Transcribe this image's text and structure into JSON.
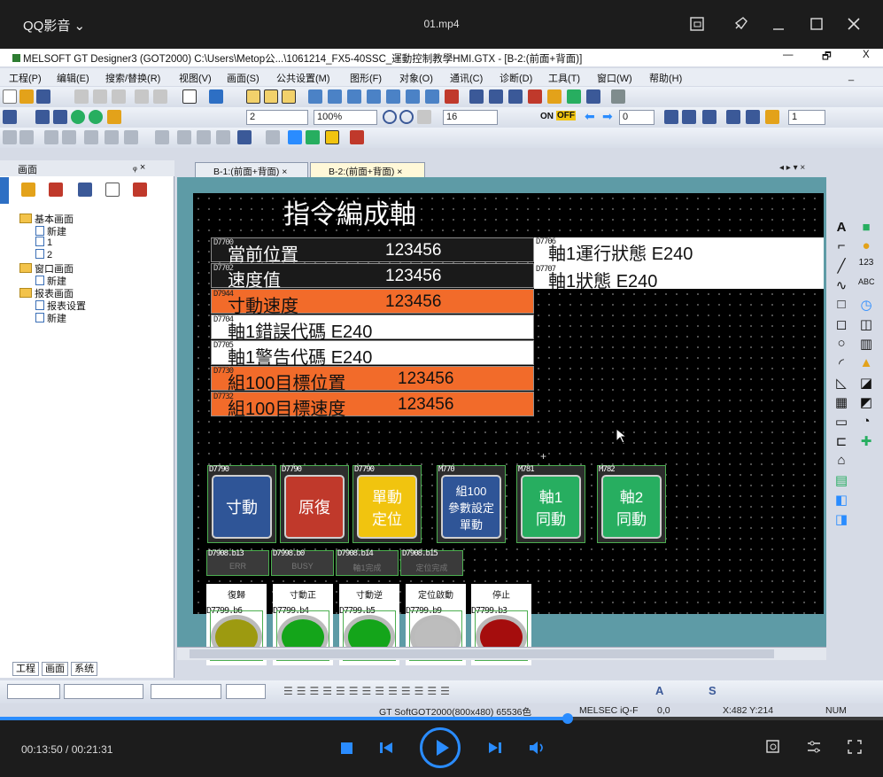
{
  "player": {
    "app_title": "QQ影音",
    "app_chevron": "⌄",
    "file": "01.mp4",
    "time": "00:13:50 / 00:21:31",
    "progress": 0.643,
    "icons": [
      "screenshot-icon",
      "pin-icon",
      "minimize-icon",
      "maximize-icon",
      "close-icon",
      "stop-icon",
      "prev-icon",
      "play-icon",
      "next-icon",
      "volume-icon",
      "capture-icon",
      "settings-icon",
      "fullscreen-icon"
    ],
    "accent": "#2a8cff"
  },
  "window": {
    "title": "MELSOFT GT Designer3 (GOT2000) C:\\Users\\Metop公...\\1061214_FX5-40SSC_運動控制教學HMI.GTX - [B-2:(前面+背面)]",
    "min": "—",
    "restore": "🗗",
    "close": "X",
    "mdi_min": "_",
    "mdi_close": "🗗 ×"
  },
  "menu": [
    "工程(P)",
    "编辑(E)",
    "搜索/替换(R)",
    "视图(V)",
    "画面(S)",
    "公共设置(M)",
    "图形(F)",
    "对象(O)",
    "通讯(C)",
    "诊断(D)",
    "工具(T)",
    "窗口(W)",
    "帮助(H)"
  ],
  "toolbar": {
    "layer": "2",
    "zoom": "100%",
    "grid": "16",
    "on_label": "ON",
    "off_label": "OFF",
    "offset": "0",
    "page": "1"
  },
  "panel": {
    "title": "画面",
    "pin": "ᵩ ×",
    "tree": [
      {
        "label": "基本画面",
        "level": 0,
        "type": "folder"
      },
      {
        "label": "新建",
        "level": 1,
        "type": "new"
      },
      {
        "label": "1",
        "level": 1,
        "type": "file"
      },
      {
        "label": "2",
        "level": 1,
        "type": "file"
      },
      {
        "label": "窗口画面",
        "level": 0,
        "type": "folder"
      },
      {
        "label": "新建",
        "level": 1,
        "type": "new"
      },
      {
        "label": "报表画面",
        "level": 0,
        "type": "folder"
      },
      {
        "label": "报表设置",
        "level": 1,
        "type": "file"
      },
      {
        "label": "新建",
        "level": 1,
        "type": "new"
      }
    ],
    "bottom_tabs": [
      "工程",
      "画面",
      "系统"
    ]
  },
  "tabs": [
    "B-1:(前面+背面)",
    "B-2:(前面+背面)"
  ],
  "tab_controls": "◂ ▸ ▾ ×",
  "hmi": {
    "title": "指令編成軸",
    "rows": [
      {
        "tag": "D7700",
        "label": "當前位置",
        "value": "123456",
        "style": "dark"
      },
      {
        "tag": "D7702",
        "label": "速度值",
        "value": "123456",
        "style": "dark"
      },
      {
        "tag": "D7944",
        "label": "寸動速度",
        "value": "123456",
        "style": "orange"
      },
      {
        "tag": "D7704",
        "label": "軸1錯誤代碼",
        "value": "E240",
        "style": "white"
      },
      {
        "tag": "D7705",
        "label": "軸1警告代碼",
        "value": "E240",
        "style": "white"
      },
      {
        "tag": "D7730",
        "label": "組100目標位置",
        "value": "123456",
        "style": "orange"
      },
      {
        "tag": "D7732",
        "label": "組100目標速度",
        "value": "123456",
        "style": "orange"
      }
    ],
    "status_rows": [
      {
        "tag": "D7706",
        "label": "軸1運行狀態",
        "value": "E240"
      },
      {
        "tag": "D7707",
        "label": "軸1狀態",
        "value": "E240"
      }
    ],
    "buttons": [
      {
        "tag": "D7790",
        "label": "寸動",
        "color": "#2f5597"
      },
      {
        "tag": "D7790",
        "label": "原復",
        "color": "#c0392b"
      },
      {
        "tag": "D7790",
        "label": "單動\n定位",
        "color": "#f1c40f"
      },
      {
        "tag": "M770",
        "label": "組100\n參數設定\n單動",
        "color": "#2f5597"
      },
      {
        "tag": "M781",
        "label": "軸1\n同動",
        "color": "#27ae60"
      },
      {
        "tag": "M782",
        "label": "軸2\n同動",
        "color": "#27ae60"
      }
    ],
    "indicators": [
      {
        "tag": "D7908.b13",
        "label": "ERR"
      },
      {
        "tag": "D7998.b0",
        "label": "BUSY"
      },
      {
        "tag": "D7908.b14",
        "label": "軸1完成"
      },
      {
        "tag": "D7908.b15",
        "label": "定位完成"
      }
    ],
    "lamps": [
      {
        "title": "復歸",
        "tag": "D7799.b6",
        "color": "#9d9a10"
      },
      {
        "title": "寸動正",
        "tag": "D7799.b4",
        "color": "#14a51a"
      },
      {
        "title": "寸動逆",
        "tag": "D7799.b5",
        "color": "#14a51a"
      },
      {
        "title": "定位啟動",
        "tag": "D7799.b9",
        "color": "#bdbdbd"
      },
      {
        "title": "停止",
        "tag": "D7799.b3",
        "color": "#a50d0d"
      }
    ]
  },
  "statusbar": {
    "target": "GT SoftGOT2000(800x480)",
    "colors": "65536色",
    "conn": "MELSEC iQ-F",
    "offset": "0,0",
    "coords": "X:482 Y:214",
    "num": "NUM"
  }
}
